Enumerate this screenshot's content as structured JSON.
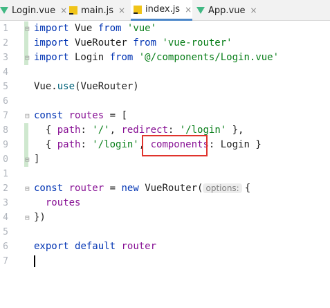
{
  "tabs": [
    {
      "label": "Login.vue",
      "icon": "vue-icon",
      "active": false
    },
    {
      "label": "main.js",
      "icon": "js-icon",
      "active": false
    },
    {
      "label": "index.js",
      "icon": "js-icon",
      "active": true
    },
    {
      "label": "App.vue",
      "icon": "vue-icon",
      "active": false
    }
  ],
  "close_glyph": "×",
  "line_numbers": [
    "1",
    "2",
    "3",
    "4",
    "5",
    "6",
    "7",
    "8",
    "9",
    "0",
    "1",
    "2",
    "3",
    "4",
    "5",
    "6",
    "7"
  ],
  "code": {
    "l1": [
      "import",
      " Vue ",
      "from",
      " ",
      "'vue'"
    ],
    "l2": [
      "import",
      " VueRouter ",
      "from",
      " ",
      "'vue-router'"
    ],
    "l3": [
      "import",
      " Login ",
      "from",
      " ",
      "'@/components/Login.vue'"
    ],
    "l5": [
      "Vue.",
      "use",
      "(VueRouter)"
    ],
    "l7": [
      "const",
      " ",
      "routes",
      " = ["
    ],
    "l8": [
      "  { ",
      "path",
      ": ",
      "'/'",
      ", ",
      "redirect",
      ": ",
      "'/login'",
      " },"
    ],
    "l9": [
      "  { ",
      "path",
      ": ",
      "'/login'",
      ", ",
      "components",
      ": Login }"
    ],
    "l10": [
      "]"
    ],
    "l12": [
      "const",
      " ",
      "router",
      " = ",
      "new",
      " VueRouter(",
      "options:",
      "{"
    ],
    "l13": [
      "  ",
      "routes"
    ],
    "l14": [
      "})"
    ],
    "l16": [
      "export",
      " ",
      "default",
      " ",
      "router"
    ]
  },
  "colors": {
    "accent": "#4a86c8",
    "highlight": "#e0332c",
    "keyword": "#0033b3",
    "string": "#067d17",
    "property": "#871094"
  }
}
